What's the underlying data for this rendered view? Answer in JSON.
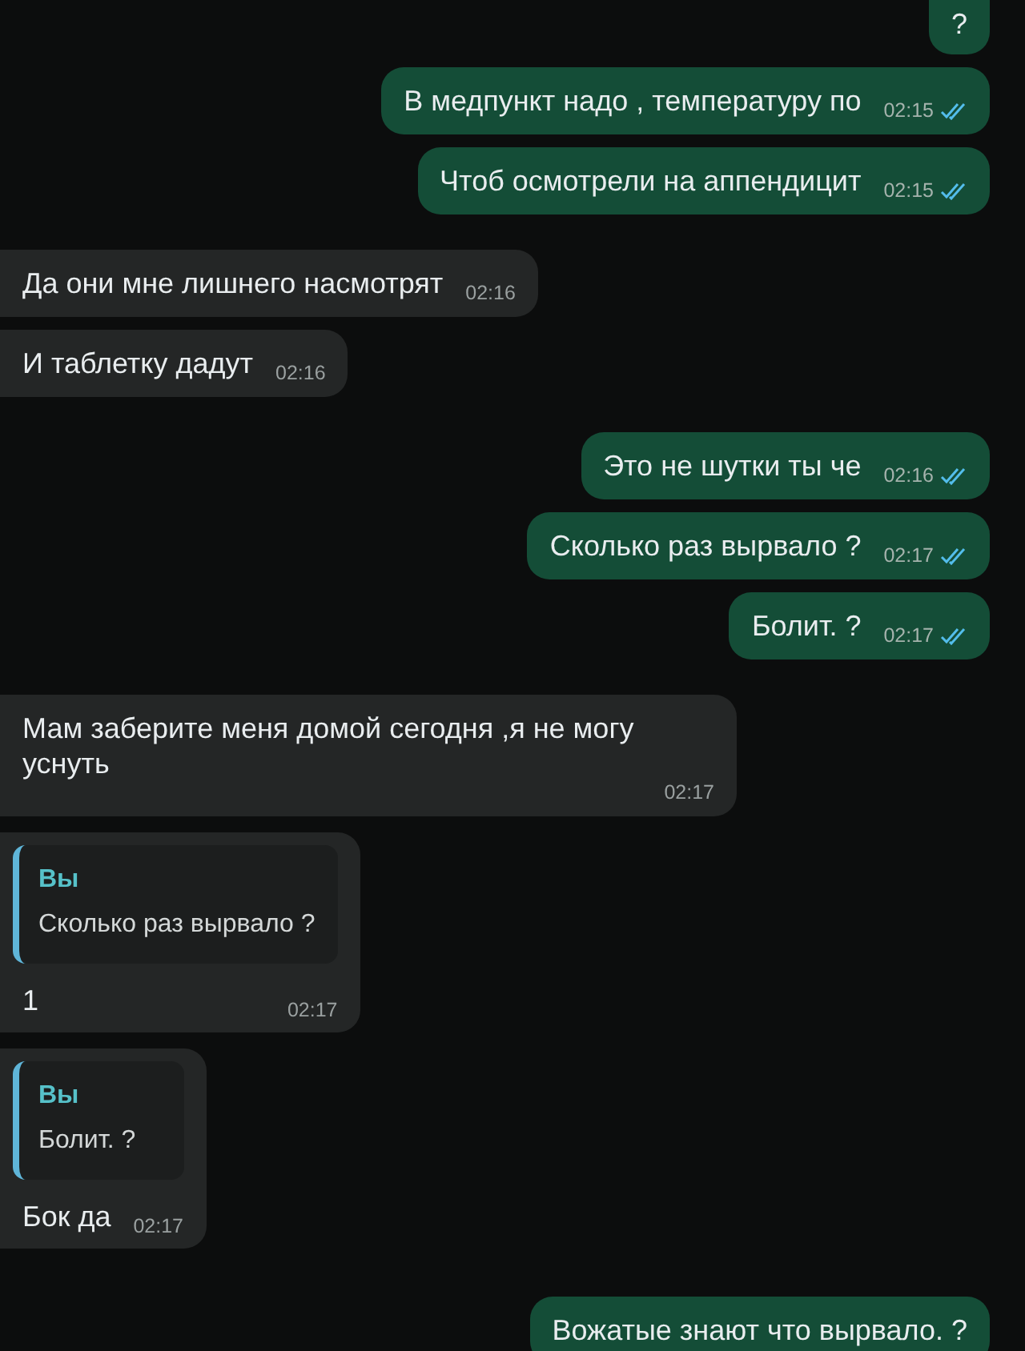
{
  "messages": [
    {
      "kind": "outgoing",
      "text": "?"
    },
    {
      "kind": "outgoing",
      "text": "В медпункт надо , температуру по",
      "time": "02:15",
      "read": true
    },
    {
      "kind": "outgoing",
      "text": "Чтоб осмотрели на аппендицит",
      "time": "02:15",
      "read": true
    },
    {
      "kind": "incoming",
      "text": "Да они мне лишнего насмотрят",
      "time": "02:16"
    },
    {
      "kind": "incoming",
      "text": "И таблетку дадут",
      "time": "02:16"
    },
    {
      "kind": "outgoing",
      "text": "Это не шутки ты че",
      "time": "02:16",
      "read": true
    },
    {
      "kind": "outgoing",
      "text": "Сколько раз вырвало ?",
      "time": "02:17",
      "read": true
    },
    {
      "kind": "outgoing",
      "text": "Болит.  ?",
      "time": "02:17",
      "read": true
    },
    {
      "kind": "incoming",
      "text": "Мам заберите меня домой сегодня ,я не могу уснуть",
      "time": "02:17"
    },
    {
      "kind": "incoming",
      "quote": {
        "author": "Вы",
        "text": "Сколько раз вырвало ?"
      },
      "text": "1",
      "time": "02:17"
    },
    {
      "kind": "incoming",
      "quote": {
        "author": "Вы",
        "text": "Болит.  ?"
      },
      "text": "Бок да",
      "time": "02:17"
    },
    {
      "kind": "outgoing",
      "text": "Вожатые знают что вырвало.  ?"
    }
  ]
}
